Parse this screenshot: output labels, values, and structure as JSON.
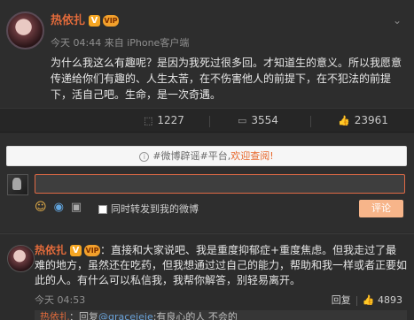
{
  "post": {
    "author": "热依扎",
    "time": "今天 04:44 来自 iPhone客户端",
    "text": "为什么我这么有趣呢？是因为我死过很多回。才知道生的意义。所以我愿意传递给你们有趣的、人生太苦，在不伤害他人的前提下，在不犯法的前提下，活自己吧。生命，是一次奇遇。",
    "badge_v": "V",
    "vip_label": "VIP"
  },
  "actions": {
    "repost_count": "1227",
    "comment_count": "3554",
    "like_count": "23961"
  },
  "composer": {
    "notice_prefix": "#微博辟谣#平台,",
    "notice_link": "欢迎查阅!",
    "input_value": "",
    "forward_label": "同时转发到我的微博",
    "submit_label": "评论"
  },
  "reply": {
    "author": "热依扎",
    "text": "：直接和大家说吧、我是重度抑郁症+重度焦虑。但我走过了最难的地方，虽然还在吃药，但我想通过过自己的能力，帮助和我一样或者正要如此的人。有什么可以私信我，我帮你解答，别轻易离开。",
    "time": "今天 04:53",
    "reply_label": "回复",
    "like_count": "4893"
  },
  "sub_reply": {
    "author": "热依扎",
    "text_prefix": "：回复",
    "mention": "@graceieie",
    "text_suffix": ":有良心的人 不会的"
  }
}
